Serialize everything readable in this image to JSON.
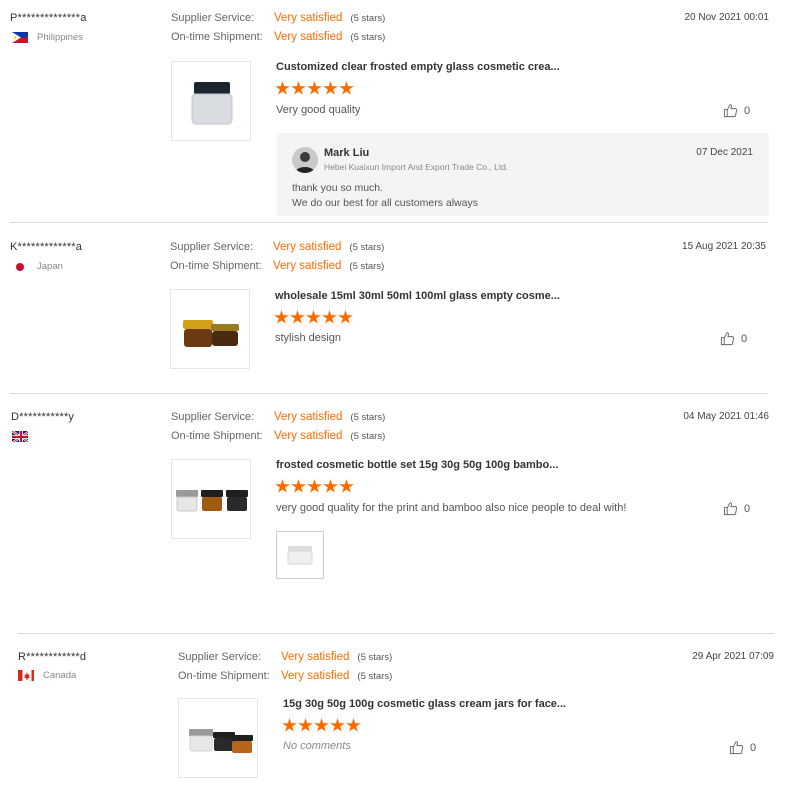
{
  "colors": {
    "accent": "#ff6a00",
    "divider": "#dcdcdc",
    "reply_bg": "#f4f4f4"
  },
  "labels": {
    "supplier_service": "Supplier Service:",
    "ontime_shipment": "On-time Shipment:"
  },
  "reviews": [
    {
      "buyer": "P**************a",
      "country": "Philippines",
      "flag": "philippines-flag-icon",
      "supplier_rating": "Very satisfied",
      "supplier_stars": "(5 stars)",
      "shipment_rating": "Very satisfied",
      "shipment_stars": "(5 stars)",
      "date": "20 Nov 2021 00:01",
      "product": "Customized clear frosted empty glass cosmetic crea...",
      "rating": 5,
      "comment": "Very good quality",
      "likes": "0",
      "reply": {
        "name": "Mark Liu",
        "company": "Hebei Kuaixun Import And Export Trade Co., Ltd.",
        "date": "07 Dec 2021",
        "line1": "thank you so much.",
        "line2": "We do our best for all customers always"
      }
    },
    {
      "buyer": "K*************a",
      "country": "Japan",
      "flag": "japan-flag-icon",
      "supplier_rating": "Very satisfied",
      "supplier_stars": "(5 stars)",
      "shipment_rating": "Very satisfied",
      "shipment_stars": "(5 stars)",
      "date": "15 Aug 2021 20:35",
      "product": "wholesale 15ml 30ml 50ml 100ml glass empty cosme...",
      "rating": 5,
      "comment": "stylish design",
      "likes": "0"
    },
    {
      "buyer": "D***********y",
      "country": "",
      "flag": "uk-flag-icon",
      "supplier_rating": "Very satisfied",
      "supplier_stars": "(5 stars)",
      "shipment_rating": "Very satisfied",
      "shipment_stars": "(5 stars)",
      "date": "04 May 2021 01:46",
      "product": "frosted cosmetic bottle set 15g 30g 50g 100g bambo...",
      "rating": 5,
      "comment": "very good quality for the print and bamboo also nice people to deal with!",
      "likes": "0"
    },
    {
      "buyer": "R************d",
      "country": "Canada",
      "flag": "canada-flag-icon",
      "supplier_rating": "Very satisfied",
      "supplier_stars": "(5 stars)",
      "shipment_rating": "Very satisfied",
      "shipment_stars": "(5 stars)",
      "date": "29 Apr 2021 07:09",
      "product": "15g 30g 50g 100g cosmetic glass cream jars for face...",
      "rating": 5,
      "comment": "No comments",
      "likes": "0"
    }
  ]
}
